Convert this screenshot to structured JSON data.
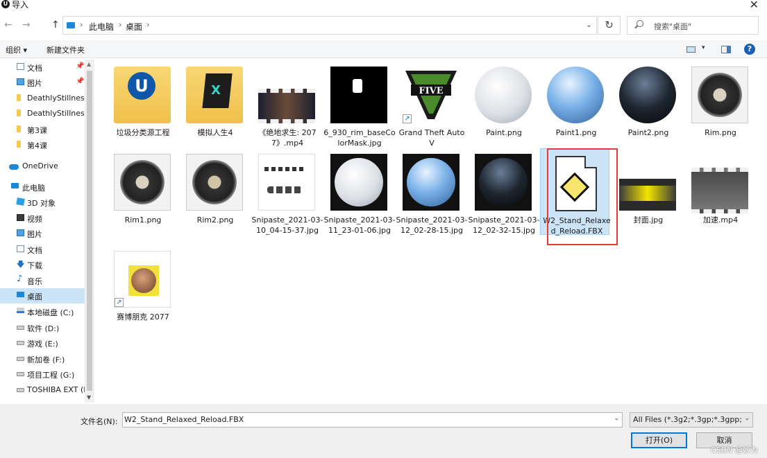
{
  "window": {
    "title": "导入",
    "icon_letter": "U",
    "close": "✕"
  },
  "nav": {
    "back": "←",
    "forward": "→",
    "up": "↑"
  },
  "address": {
    "crumbs": [
      "此电脑",
      "桌面"
    ],
    "separator": "›",
    "dropdown": "⌄",
    "refresh": "↻"
  },
  "search": {
    "placeholder": "搜索\"桌面\""
  },
  "toolbar": {
    "organize": "组织 ▾",
    "new_folder": "新建文件夹",
    "view_dd": "▾",
    "help": "?"
  },
  "sidebar": {
    "items": [
      {
        "label": "文档",
        "icon": "document-icon",
        "pinned": true
      },
      {
        "label": "图片",
        "icon": "picture-icon",
        "pinned": true
      },
      {
        "label": "DeathlyStillness",
        "icon": "folder-icon"
      },
      {
        "label": "DeathlyStillness",
        "icon": "folder-icon"
      },
      {
        "label": "第3课",
        "icon": "folder-icon"
      },
      {
        "label": "第4课",
        "icon": "folder-icon"
      },
      {
        "label": "OneDrive",
        "icon": "onedrive-icon"
      },
      {
        "label": "此电脑",
        "icon": "pc-icon"
      },
      {
        "label": "3D 对象",
        "icon": "3d-objects-icon"
      },
      {
        "label": "视频",
        "icon": "video-icon"
      },
      {
        "label": "图片",
        "icon": "picture-icon"
      },
      {
        "label": "文档",
        "icon": "document-icon"
      },
      {
        "label": "下载",
        "icon": "download-icon"
      },
      {
        "label": "音乐",
        "icon": "music-icon"
      },
      {
        "label": "桌面",
        "icon": "desktop-icon",
        "selected": true
      },
      {
        "label": "本地磁盘 (C:)",
        "icon": "drive-c-icon"
      },
      {
        "label": "软件 (D:)",
        "icon": "drive-icon"
      },
      {
        "label": "游戏 (E:)",
        "icon": "drive-icon"
      },
      {
        "label": "新加卷 (F:)",
        "icon": "drive-icon"
      },
      {
        "label": "项目工程 (G:)",
        "icon": "drive-icon"
      },
      {
        "label": "TOSHIBA EXT (H:)",
        "icon": "drive-icon"
      }
    ],
    "pin_glyph": "📌",
    "down_glyph": "🡇",
    "music_glyph": "♪"
  },
  "files": [
    {
      "name": "垃圾分类源工程",
      "kind": "folder-ue"
    },
    {
      "name": "模拟人生4",
      "kind": "folder-ts"
    },
    {
      "name": "《绝地求生: 2077》.mp4",
      "kind": "video"
    },
    {
      "name": "6_930_rim_baseColorMask.jpg",
      "kind": "mask"
    },
    {
      "name": "Grand Theft Auto V",
      "kind": "gtav",
      "shortcut": true,
      "logo_text": "FIVE"
    },
    {
      "name": "Paint.png",
      "kind": "sphere-paint"
    },
    {
      "name": "Paint1.png",
      "kind": "sphere-paint1"
    },
    {
      "name": "Paint2.png",
      "kind": "sphere-paint2"
    },
    {
      "name": "Rim.png",
      "kind": "wheel"
    },
    {
      "name": "Rim1.png",
      "kind": "wheel"
    },
    {
      "name": "Rim2.png",
      "kind": "wheel"
    },
    {
      "name": "Snipaste_2021-03-10_04-15-37.jpg",
      "kind": "snip"
    },
    {
      "name": "Snipaste_2021-03-11_23-01-06.jpg",
      "kind": "sq-paint"
    },
    {
      "name": "Snipaste_2021-03-12_02-28-15.jpg",
      "kind": "sq-paint1"
    },
    {
      "name": "Snipaste_2021-03-12_02-32-15.jpg",
      "kind": "sq-paint2"
    },
    {
      "name": "W2_Stand_Relaxed_Reload.FBX",
      "kind": "fbx",
      "selected": true
    },
    {
      "name": "封面.jpg",
      "kind": "cyber"
    },
    {
      "name": "加速.mp4",
      "kind": "video"
    },
    {
      "name": "赛博朋克 2077",
      "kind": "avatar",
      "shortcut": true
    }
  ],
  "shortcut_glyph": "↗",
  "bottom": {
    "filename_label": "文件名(N):",
    "filename_value": "W2_Stand_Relaxed_Reload.FBX",
    "filetype_value": "All Files (*.3g2;*.3gp;*.3gpp;",
    "open_label": "打开(O)",
    "cancel_label": "取消",
    "dd": "⌄"
  },
  "watermark": "CSDN @妙为",
  "colors": {
    "accent": "#0078d7",
    "selection": "#cce4f7",
    "highlight_box": "#e53935"
  }
}
